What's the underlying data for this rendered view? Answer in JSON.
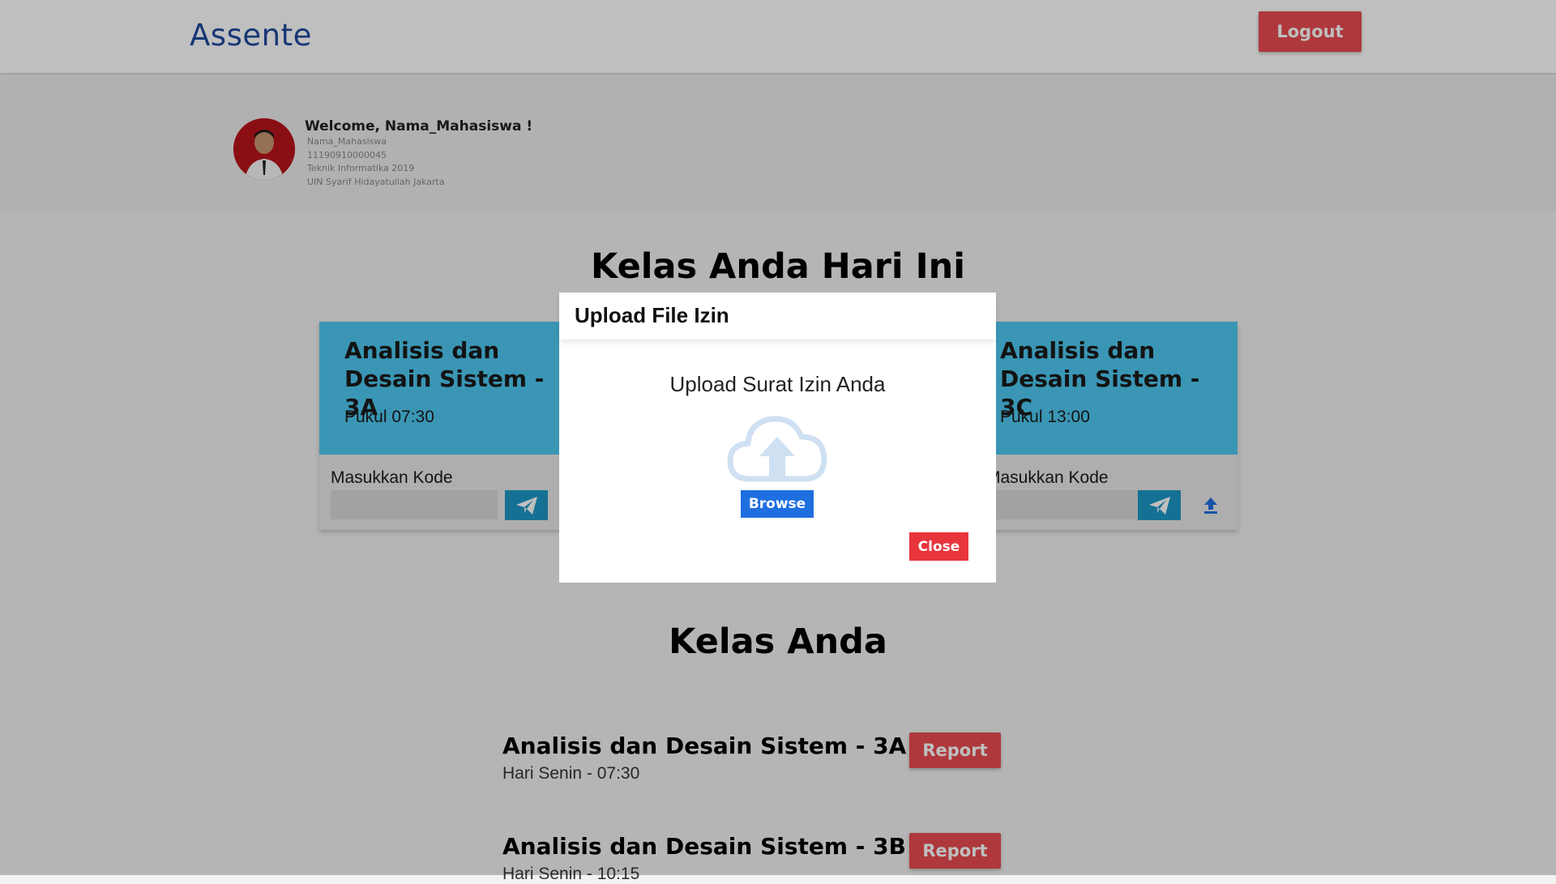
{
  "navbar": {
    "brand": "Assente",
    "logout_label": "Logout"
  },
  "profile": {
    "welcome": "Welcome, Nama_Mahasiswa !",
    "name": "Nama_Mahasiswa",
    "nim": "11190910000045",
    "program": "Teknik Informatika 2019",
    "university": "UIN Syarif Hidayatullah Jakarta"
  },
  "today": {
    "title": "Kelas Anda Hari Ini",
    "cards": [
      {
        "title": "Analisis dan Desain Sistem - 3A",
        "time": "Pukul 07:30",
        "code_label": "Masukkan Kode"
      },
      {
        "title": "Analisis dan Desain Sistem - 3C",
        "time": "Pukul 13:00",
        "code_label": "Masukkan Kode"
      }
    ]
  },
  "classes": {
    "title": "Kelas Anda",
    "items": [
      {
        "name": "Analisis dan Desain Sistem - 3A",
        "schedule": "Hari Senin - 07:30",
        "report_label": "Report"
      },
      {
        "name": "Analisis dan Desain Sistem - 3B",
        "schedule": "Hari Senin - 10:15",
        "report_label": "Report"
      }
    ]
  },
  "modal": {
    "title": "Upload File Izin",
    "body": "Upload Surat Izin Anda",
    "browse_label": "Browse",
    "close_label": "Close"
  },
  "colors": {
    "brand": "#1f4a9c",
    "card_header": "#4ec8f0",
    "danger": "#e84b50",
    "send_button": "#1d97c4",
    "browse_button": "#1f6fe0"
  },
  "icons": {
    "send": "paper-plane-icon",
    "upload": "upload-icon",
    "cloud": "cloud-upload-icon"
  }
}
